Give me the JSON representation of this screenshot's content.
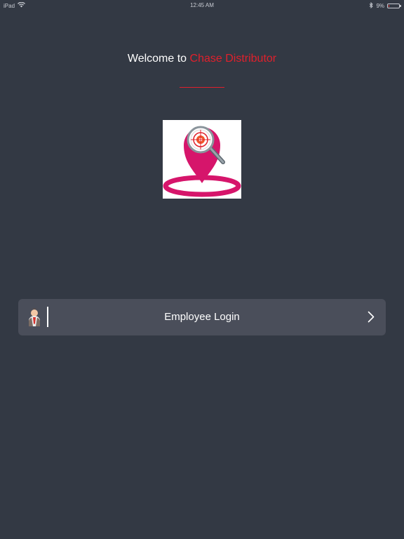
{
  "status_bar": {
    "device": "iPad",
    "time": "12:45 AM",
    "battery_percent": "9%",
    "battery_level": 0.09,
    "icons": [
      "wifi-icon",
      "bluetooth-icon",
      "battery-icon"
    ]
  },
  "welcome": {
    "prefix": "Welcome to",
    "brand": "Chase Distributor"
  },
  "logo": {
    "icon": "map-pin-search-icon"
  },
  "login": {
    "label": "Employee Login",
    "icon": "employee-icon",
    "chevron_icon": "chevron-right-icon"
  },
  "colors": {
    "background": "#333944",
    "accent": "#e0202c",
    "row": "#4a4e5a",
    "logo_pink": "#d6156b"
  }
}
